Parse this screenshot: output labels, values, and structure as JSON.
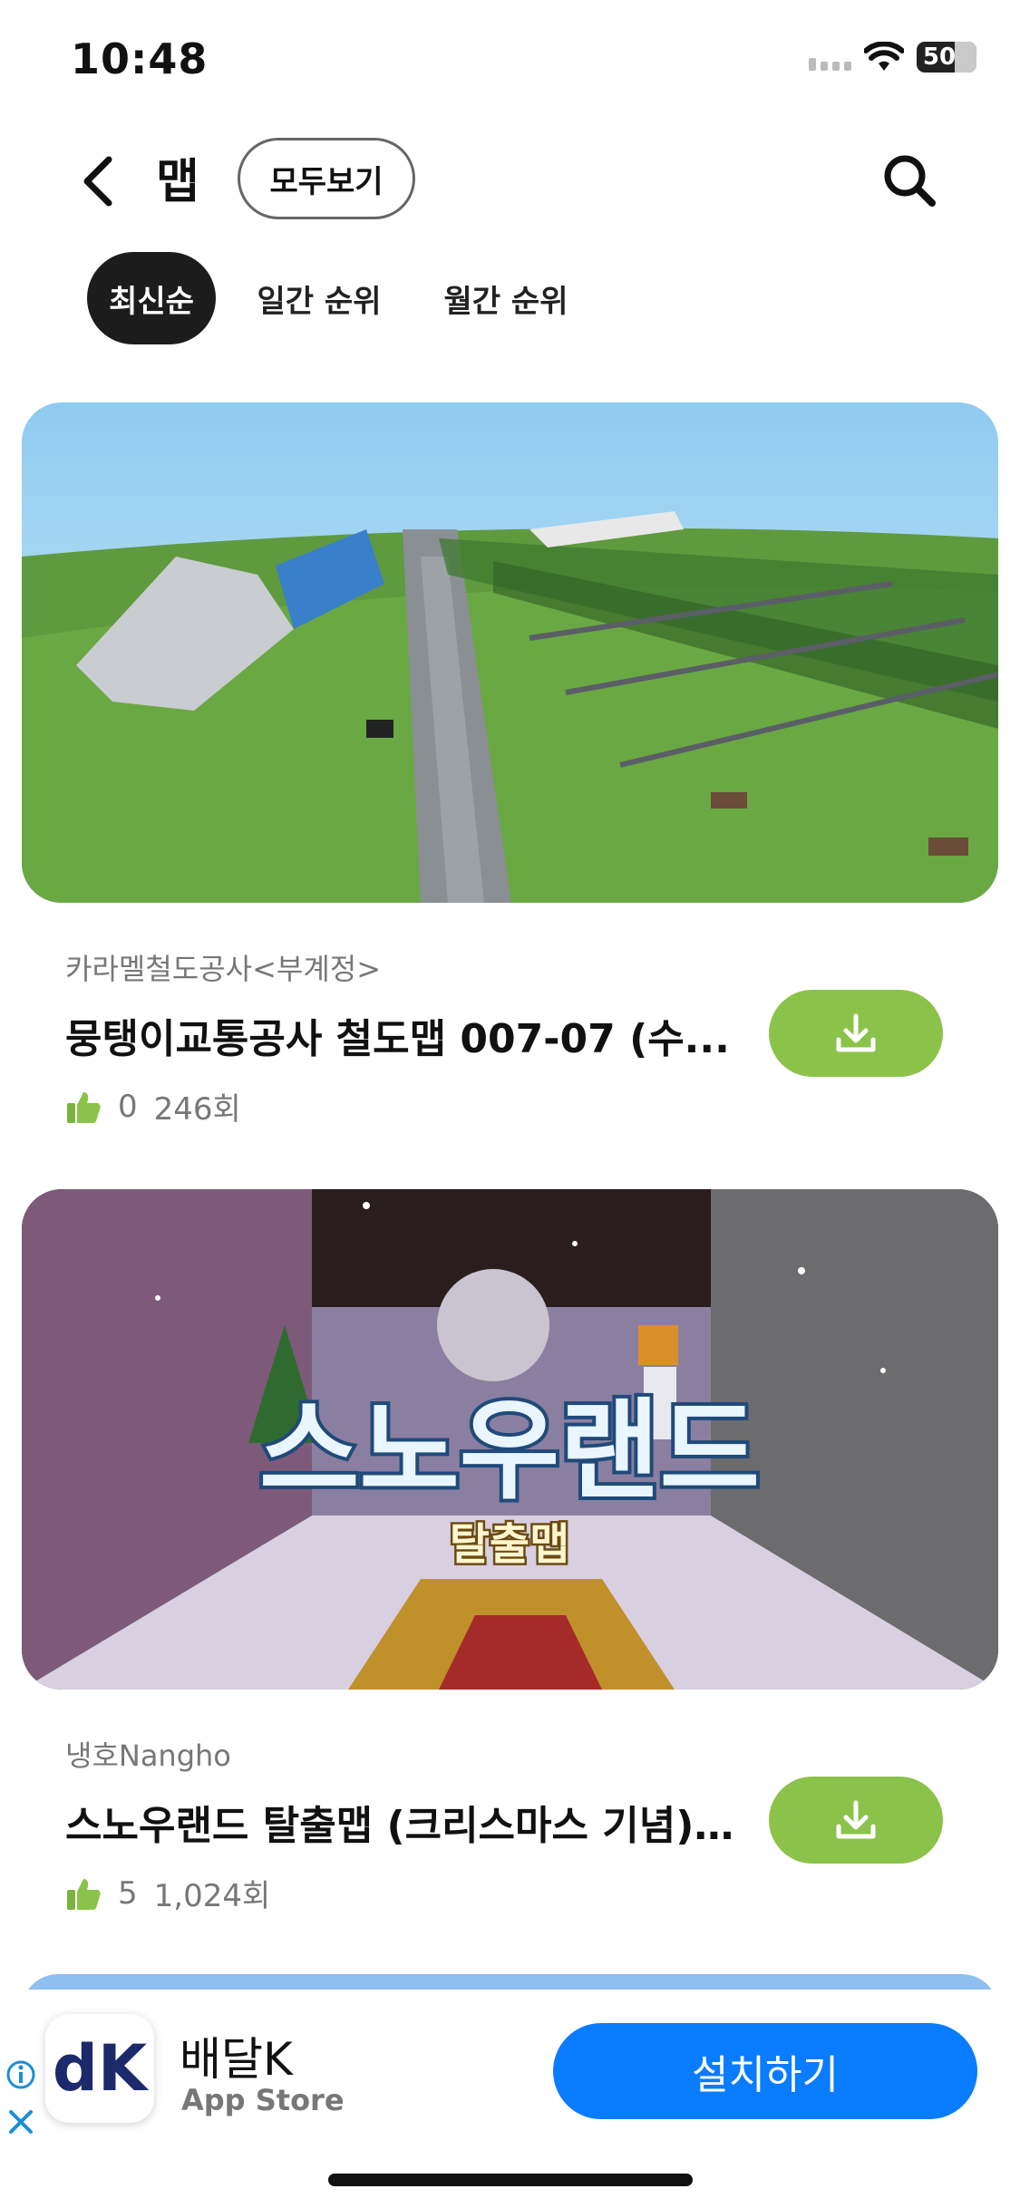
{
  "status": {
    "time": "10:48",
    "battery": "50"
  },
  "header": {
    "title": "맵",
    "view_all": "모두보기"
  },
  "tabs": [
    {
      "label": "최신순",
      "active": true
    },
    {
      "label": "일간 순위",
      "active": false
    },
    {
      "label": "월간 순위",
      "active": false
    }
  ],
  "maps": [
    {
      "author": "카라멜철도공사<부계정>",
      "title": "뭉탱이교통공사 철도맵 007-07 (수...",
      "likes": "0",
      "downloads": "246회"
    },
    {
      "author": "냉호Nangho",
      "title": "스노우랜드 탈출맵 (크리스마스 기념)...",
      "likes": "5",
      "downloads": "1,024회",
      "thumb_title": "스노우랜드",
      "thumb_subtitle": "탈출맵"
    }
  ],
  "ad": {
    "logo_text": "dK",
    "app_name": "배달K",
    "store": "App Store",
    "install_label": "설치하기"
  },
  "colors": {
    "download_green": "#8bc34a",
    "install_blue": "#0a7cff",
    "tab_active": "#1c1c1c"
  },
  "icons": [
    "back-chevron-icon",
    "search-icon",
    "download-icon",
    "thumbs-up-icon",
    "info-icon",
    "close-icon",
    "wifi-icon",
    "battery-icon"
  ]
}
